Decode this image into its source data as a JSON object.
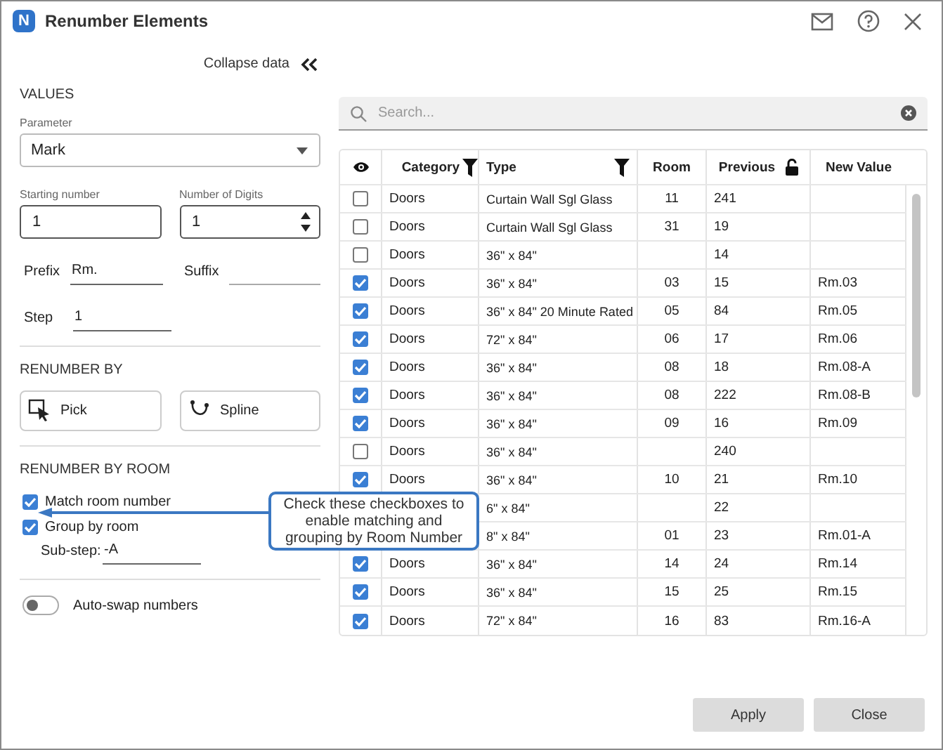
{
  "window": {
    "title": "Renumber Elements",
    "logo": "N"
  },
  "collapse": {
    "label": "Collapse data"
  },
  "values": {
    "heading": "VALUES",
    "parameter": {
      "label": "Parameter",
      "value": "Mark"
    },
    "starting_number": {
      "label": "Starting number",
      "value": "1"
    },
    "digits": {
      "label": "Number of Digits",
      "value": "1"
    },
    "prefix": {
      "label": "Prefix",
      "value": "Rm."
    },
    "suffix": {
      "label": "Suffix"
    },
    "step": {
      "label": "Step",
      "value": "1"
    }
  },
  "renumber_by": {
    "heading": "RENUMBER BY",
    "buttons": [
      {
        "label": "Pick",
        "kind": "pick"
      },
      {
        "label": "Spline",
        "kind": "spline"
      }
    ]
  },
  "renumber_by_room": {
    "heading": "RENUMBER BY ROOM",
    "options": [
      {
        "label": "Match room number",
        "checked": true
      },
      {
        "label": "Group by room",
        "checked": true
      }
    ],
    "substep": {
      "label": "Sub-step:",
      "value": "-A"
    },
    "auto_swap": {
      "label": "Auto-swap numbers",
      "on": false
    }
  },
  "search": {
    "placeholder": "Search..."
  },
  "table": {
    "columns": [
      {
        "kind": "eye"
      },
      {
        "label": "Category",
        "kind": "filter"
      },
      {
        "label": "Type",
        "kind": "filter"
      },
      {
        "label": "Room",
        "kind": "plain"
      },
      {
        "label": "Previous",
        "kind": "lock"
      },
      {
        "label": "New Value",
        "kind": "plain"
      }
    ],
    "rows": [
      {
        "checked": false,
        "category": "Doors",
        "type": "Curtain Wall Sgl Glass",
        "room": "11",
        "previous": "241"
      },
      {
        "checked": false,
        "category": "Doors",
        "type": "Curtain Wall Sgl Glass",
        "room": "31",
        "previous": "19"
      },
      {
        "checked": false,
        "category": "Doors",
        "type": "36\" x 84\"",
        "previous": "14"
      },
      {
        "checked": true,
        "category": "Doors",
        "type": "36\" x 84\"",
        "room": "03",
        "previous": "15",
        "new_value": "Rm.03"
      },
      {
        "checked": true,
        "category": "Doors",
        "type": "36\" x 84\" 20 Minute Rated",
        "room": "05",
        "previous": "84",
        "new_value": "Rm.05"
      },
      {
        "checked": true,
        "category": "Doors",
        "type": "72\" x 84\"",
        "room": "06",
        "previous": "17",
        "new_value": "Rm.06"
      },
      {
        "checked": true,
        "category": "Doors",
        "type": "36\" x 84\"",
        "room": "08",
        "previous": "18",
        "new_value": "Rm.08-A"
      },
      {
        "checked": true,
        "category": "Doors",
        "type": "36\" x 84\"",
        "room": "08",
        "previous": "222",
        "new_value": "Rm.08-B"
      },
      {
        "checked": true,
        "category": "Doors",
        "type": "36\" x 84\"",
        "room": "09",
        "previous": "16",
        "new_value": "Rm.09"
      },
      {
        "checked": false,
        "category": "Doors",
        "type": "36\" x 84\"",
        "previous": "240"
      },
      {
        "checked": true,
        "category": "Doors",
        "type": "36\" x 84\"",
        "room": "10",
        "previous": "21",
        "new_value": "Rm.10"
      },
      {
        "type": "6\" x 84\"",
        "previous": "22"
      },
      {
        "type": "8\" x 84\"",
        "room": "01",
        "previous": "23",
        "new_value": "Rm.01-A"
      },
      {
        "checked": true,
        "category": "Doors",
        "type": "36\" x 84\"",
        "room": "14",
        "previous": "24",
        "new_value": "Rm.14"
      },
      {
        "checked": true,
        "category": "Doors",
        "type": "36\" x 84\"",
        "room": "15",
        "previous": "25",
        "new_value": "Rm.15"
      },
      {
        "checked": true,
        "category": "Doors",
        "type": "72\" x 84\"",
        "room": "16",
        "previous": "83",
        "new_value": "Rm.16-A"
      }
    ]
  },
  "callout": {
    "text": "Check these checkboxes to enable matching and grouping by Room Number"
  },
  "buttons": [
    "Apply",
    "Close"
  ]
}
